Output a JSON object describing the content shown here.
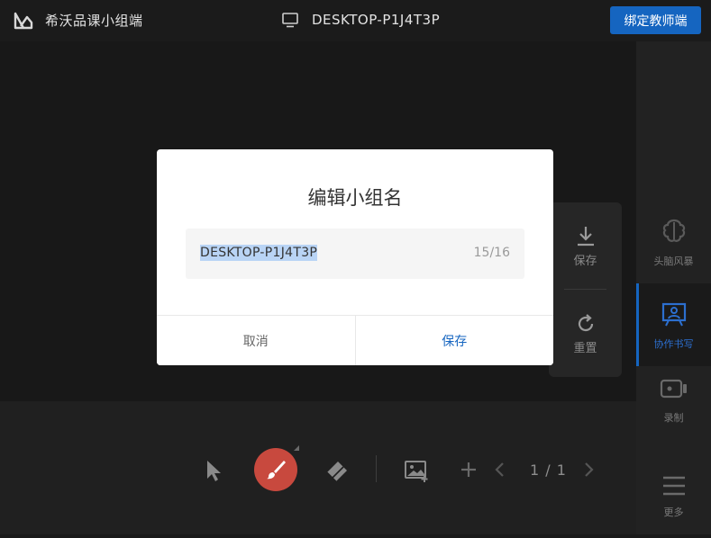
{
  "header": {
    "app_title": "希沃品课小组端",
    "device_name": "DESKTOP-P1J4T3P",
    "bind_button": "绑定教师端"
  },
  "float_panel": {
    "save_label": "保存",
    "reset_label": "重置"
  },
  "sidebar": {
    "items": [
      {
        "label": "头脑风暴",
        "icon": "brain-icon",
        "active": false
      },
      {
        "label": "协作书写",
        "icon": "collab-writing-icon",
        "active": true
      },
      {
        "label": "录制",
        "icon": "record-icon",
        "active": false
      },
      {
        "label": "更多",
        "icon": "menu-icon",
        "active": false
      }
    ]
  },
  "toolbar": {
    "page_indicator": "1 / 1"
  },
  "modal": {
    "title": "编辑小组名",
    "input_value": "DESKTOP-P1J4T3P",
    "counter": "15/16",
    "cancel_label": "取消",
    "save_label": "保存"
  },
  "colors": {
    "accent": "#1565c0",
    "brush_active": "#c8493e",
    "selection": "#b9d4f5"
  }
}
